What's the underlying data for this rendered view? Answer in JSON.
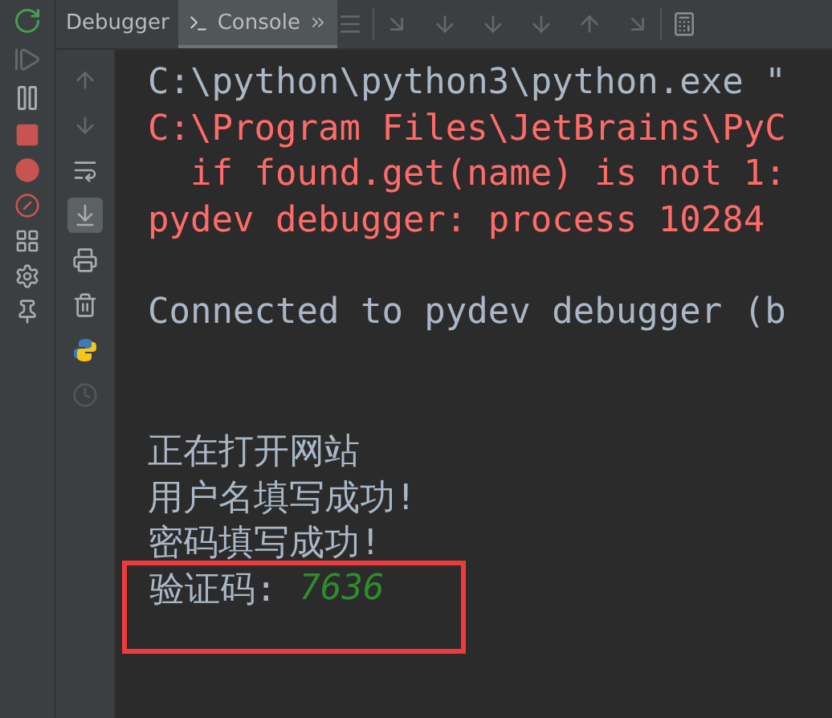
{
  "tabs": [
    {
      "label": "Debugger",
      "selected": false
    },
    {
      "label": "Console",
      "selected": true
    }
  ],
  "console_tools": [
    {
      "kind": "up",
      "selected": false
    },
    {
      "kind": "down",
      "selected": false
    },
    {
      "kind": "wrap",
      "selected": false
    },
    {
      "kind": "scroll",
      "selected": true
    },
    {
      "kind": "print",
      "selected": false
    },
    {
      "kind": "trash",
      "selected": false
    },
    {
      "kind": "python",
      "selected": false
    },
    {
      "kind": "history",
      "selected": false
    }
  ],
  "lines": [
    {
      "kind": "normal",
      "text": "C:\\python\\python3\\python.exe \"",
      "highlighted": false
    },
    {
      "kind": "error",
      "text": "C:\\Program Files\\JetBrains\\PyC",
      "highlighted": false
    },
    {
      "kind": "error",
      "text": "  if found.get(name) is not 1:",
      "highlighted": false
    },
    {
      "kind": "error",
      "text": "pydev debugger: process 10284",
      "highlighted": false
    },
    {
      "kind": "blank",
      "highlighted": false
    },
    {
      "kind": "normal",
      "text": "Connected to pydev debugger (b",
      "highlighted": false
    },
    {
      "kind": "blank",
      "highlighted": false
    },
    {
      "kind": "blank",
      "highlighted": false
    },
    {
      "kind": "normal",
      "text": "正在打开网站",
      "highlighted": false
    },
    {
      "kind": "normal",
      "text": "用户名填写成功!",
      "highlighted": false
    },
    {
      "kind": "normal",
      "text": "密码填写成功!",
      "highlighted": false
    },
    {
      "kind": "result",
      "text": "验证码:",
      "value": "7636",
      "highlighted": true
    }
  ]
}
